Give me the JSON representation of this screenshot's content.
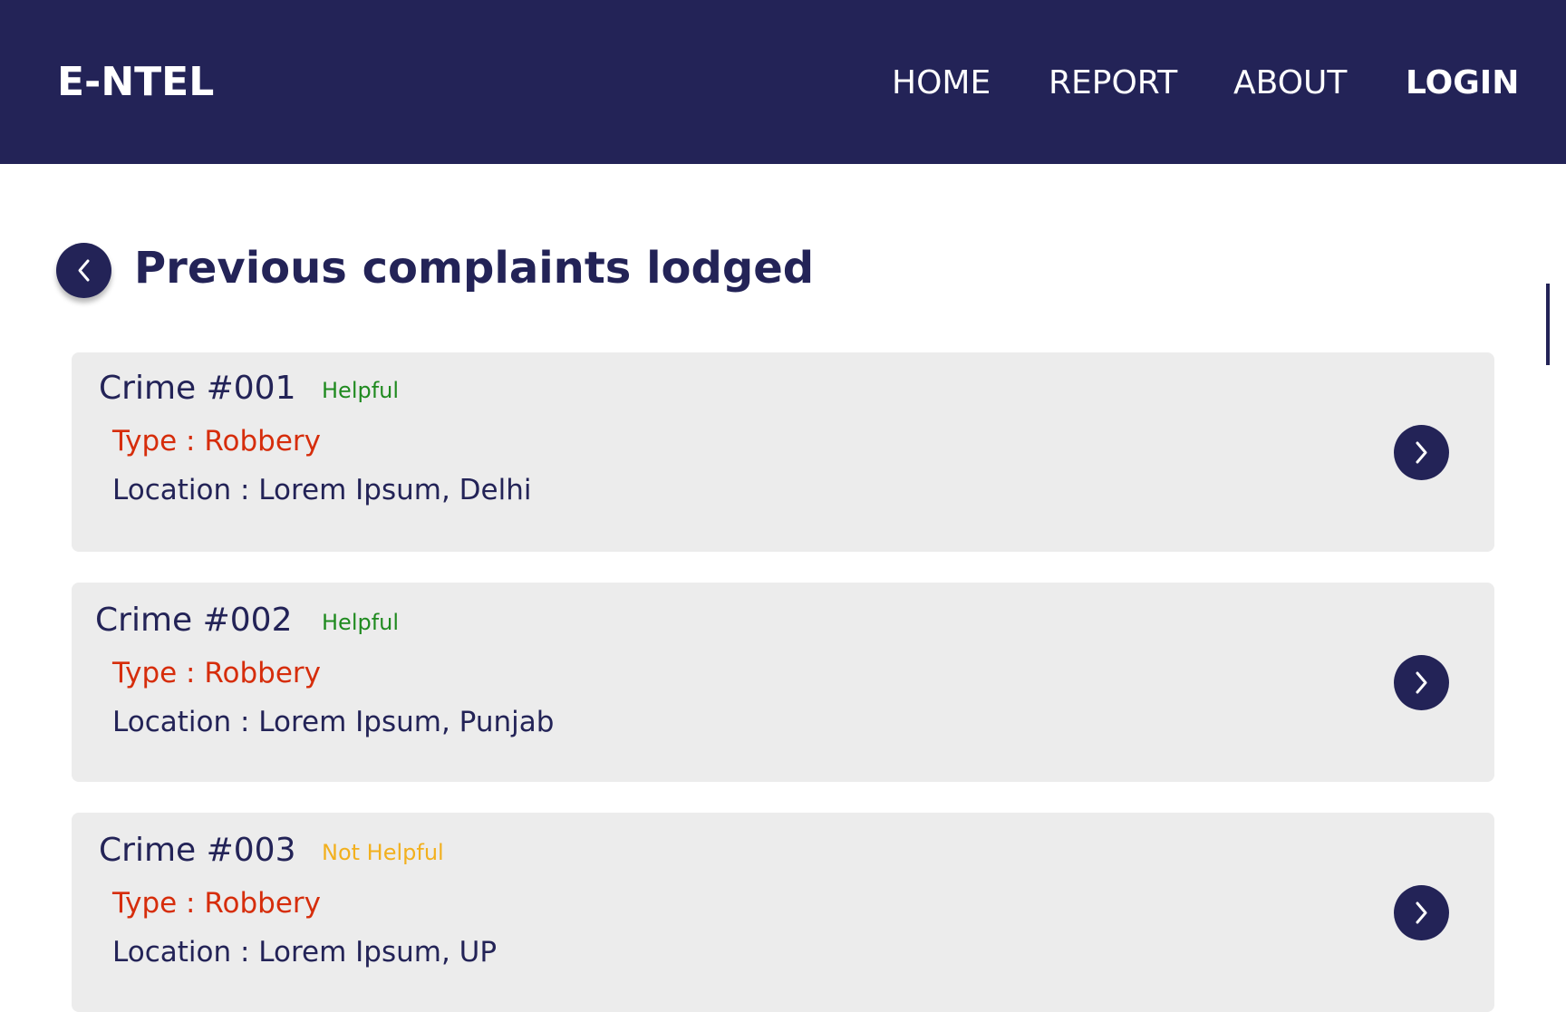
{
  "header": {
    "logo": "E-NTEL",
    "nav": [
      "HOME",
      "REPORT",
      "ABOUT",
      "LOGIN"
    ]
  },
  "page": {
    "title": "Previous complaints lodged"
  },
  "colors": {
    "primary": "#232357",
    "card_bg": "#ececec",
    "type_text": "#d62d0b",
    "helpful": "#1f8a1f",
    "not_helpful": "#f2b01e"
  },
  "complaints": [
    {
      "title": "Crime #001",
      "status": "Helpful",
      "type": "Type : Robbery",
      "location": "Location : Lorem Ipsum, Delhi"
    },
    {
      "title": "Crime #002",
      "status": "Helpful",
      "type": "Type : Robbery",
      "location": "Location : Lorem Ipsum, Punjab"
    },
    {
      "title": "Crime #003",
      "status": "Not Helpful",
      "type": "Type : Robbery",
      "location": "Location : Lorem Ipsum, UP"
    }
  ]
}
